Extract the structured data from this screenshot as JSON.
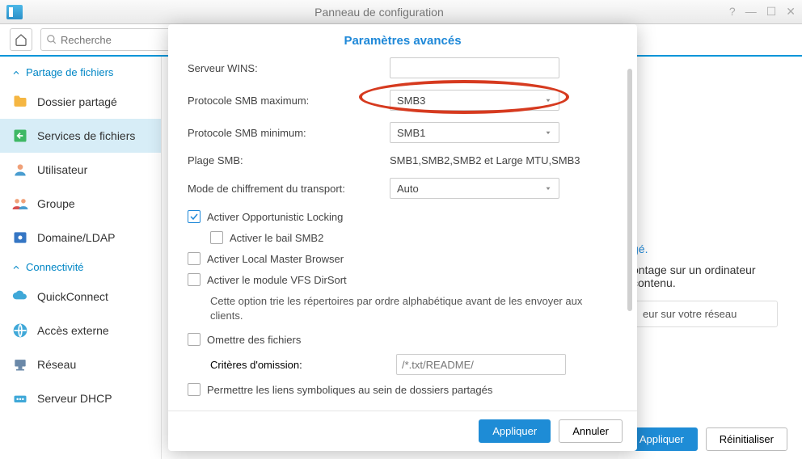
{
  "window": {
    "title": "Panneau de configuration"
  },
  "search": {
    "placeholder": "Recherche"
  },
  "sidebar": {
    "section1": "Partage de fichiers",
    "items1": [
      {
        "label": "Dossier partagé"
      },
      {
        "label": "Services de fichiers"
      },
      {
        "label": "Utilisateur"
      },
      {
        "label": "Groupe"
      },
      {
        "label": "Domaine/LDAP"
      }
    ],
    "section2": "Connectivité",
    "items2": [
      {
        "label": "QuickConnect"
      },
      {
        "label": "Accès externe"
      },
      {
        "label": "Réseau"
      },
      {
        "label": "Serveur DHCP"
      }
    ]
  },
  "modal": {
    "title": "Paramètres avancés",
    "fields": {
      "wins_label": "Serveur WINS:",
      "wins_value": "",
      "smb_max_label": "Protocole SMB maximum:",
      "smb_max_value": "SMB3",
      "smb_min_label": "Protocole SMB minimum:",
      "smb_min_value": "SMB1",
      "smb_range_label": "Plage SMB:",
      "smb_range_value": "SMB1,SMB2,SMB2 et Large MTU,SMB3",
      "transport_label": "Mode de chiffrement du transport:",
      "transport_value": "Auto"
    },
    "checkboxes": {
      "oplock": "Activer Opportunistic Locking",
      "smb2_lease": "Activer le bail SMB2",
      "local_master": "Activer Local Master Browser",
      "vfs_dirsort": "Activer le module VFS DirSort",
      "vfs_desc": "Cette option trie les répertoires par ordre alphabétique avant de les envoyer aux clients.",
      "omit_files": "Omettre des fichiers",
      "omit_criteria_label": "Critères d'omission:",
      "omit_criteria_placeholder": "/*.txt/README/",
      "symlinks": "Permettre les liens symboliques au sein de dossiers partagés"
    },
    "buttons": {
      "apply": "Appliquer",
      "cancel": "Annuler"
    }
  },
  "background": {
    "link_suffix": "gé.",
    "line1": "ontage sur un ordinateur",
    "line2": "contenu.",
    "card": "eur sur votre réseau"
  },
  "main_buttons": {
    "apply": "Appliquer",
    "reset": "Réinitialiser"
  }
}
